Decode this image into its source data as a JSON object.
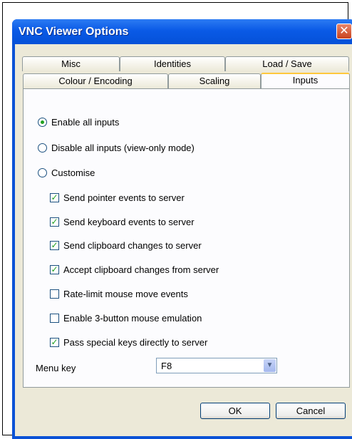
{
  "window": {
    "title": "VNC Viewer Options",
    "close_glyph": "✕"
  },
  "tabs_row_back": [
    {
      "label": "Misc"
    },
    {
      "label": "Identities"
    },
    {
      "label": "Load / Save"
    }
  ],
  "tabs_row_front": [
    {
      "label": "Colour / Encoding",
      "active": false
    },
    {
      "label": "Scaling",
      "active": false
    },
    {
      "label": "Inputs",
      "active": true
    }
  ],
  "inputs": {
    "enable_all": {
      "label": "Enable all inputs",
      "selected": true
    },
    "disable_all": {
      "label": "Disable all inputs (view-only mode)",
      "selected": false
    },
    "customise": {
      "label": "Customise",
      "selected": false
    },
    "options": [
      {
        "label": "Send pointer events to server",
        "checked": true
      },
      {
        "label": "Send keyboard events to server",
        "checked": true
      },
      {
        "label": "Send clipboard changes to server",
        "checked": true
      },
      {
        "label": "Accept clipboard changes from server",
        "checked": true
      },
      {
        "label": "Rate-limit mouse move events",
        "checked": false
      },
      {
        "label": "Enable 3-button mouse emulation",
        "checked": false
      },
      {
        "label": "Pass special keys directly to server",
        "checked": true
      }
    ],
    "menu_key": {
      "label": "Menu key",
      "value": "F8"
    }
  },
  "buttons": {
    "ok": "OK",
    "cancel": "Cancel"
  },
  "check_glyph": "✓"
}
